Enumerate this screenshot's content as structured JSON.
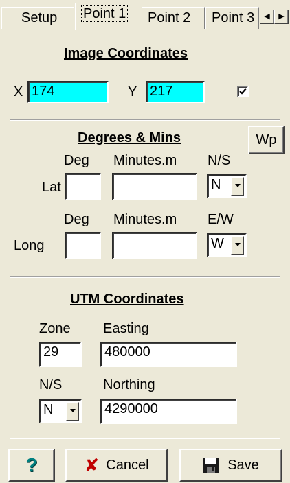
{
  "tabs": [
    "Setup",
    "Point 1",
    "Point 2",
    "Point 3"
  ],
  "image_coordinates": {
    "heading": "Image Coordinates",
    "x_label": "X",
    "x_value": "174",
    "y_label": "Y",
    "y_value": "217",
    "checked": true
  },
  "degrees_mins": {
    "heading": "Degrees & Mins",
    "wp_button": "Wp",
    "lat": {
      "deg_label": "Deg",
      "min_label": "Minutes.m",
      "dir_label": "N/S",
      "row_label": "Lat",
      "deg": "",
      "min": "",
      "dir": "N"
    },
    "long": {
      "deg_label": "Deg",
      "min_label": "Minutes.m",
      "dir_label": "E/W",
      "row_label": "Long",
      "deg": "",
      "min": "",
      "dir": "W"
    }
  },
  "utm": {
    "heading": "UTM Coordinates",
    "zone_label": "Zone",
    "zone": "29",
    "easting_label": "Easting",
    "easting": "480000",
    "ns_label": "N/S",
    "ns": "N",
    "northing_label": "Northing",
    "northing": "4290000"
  },
  "footer": {
    "help": "?",
    "cancel": "Cancel",
    "save": "Save"
  }
}
